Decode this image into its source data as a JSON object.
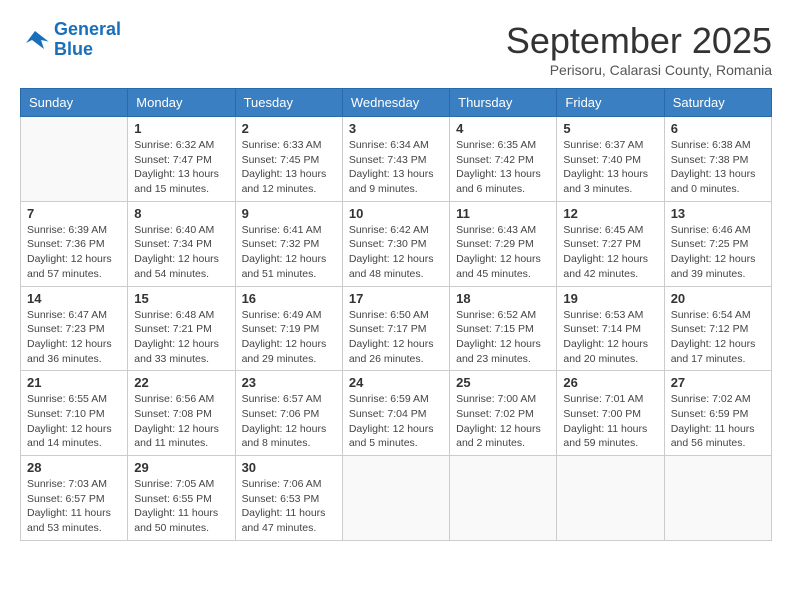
{
  "logo": {
    "line1": "General",
    "line2": "Blue"
  },
  "title": "September 2025",
  "subtitle": "Perisoru, Calarasi County, Romania",
  "days_of_week": [
    "Sunday",
    "Monday",
    "Tuesday",
    "Wednesday",
    "Thursday",
    "Friday",
    "Saturday"
  ],
  "weeks": [
    [
      {
        "day": "",
        "info": ""
      },
      {
        "day": "1",
        "info": "Sunrise: 6:32 AM\nSunset: 7:47 PM\nDaylight: 13 hours\nand 15 minutes."
      },
      {
        "day": "2",
        "info": "Sunrise: 6:33 AM\nSunset: 7:45 PM\nDaylight: 13 hours\nand 12 minutes."
      },
      {
        "day": "3",
        "info": "Sunrise: 6:34 AM\nSunset: 7:43 PM\nDaylight: 13 hours\nand 9 minutes."
      },
      {
        "day": "4",
        "info": "Sunrise: 6:35 AM\nSunset: 7:42 PM\nDaylight: 13 hours\nand 6 minutes."
      },
      {
        "day": "5",
        "info": "Sunrise: 6:37 AM\nSunset: 7:40 PM\nDaylight: 13 hours\nand 3 minutes."
      },
      {
        "day": "6",
        "info": "Sunrise: 6:38 AM\nSunset: 7:38 PM\nDaylight: 13 hours\nand 0 minutes."
      }
    ],
    [
      {
        "day": "7",
        "info": "Sunrise: 6:39 AM\nSunset: 7:36 PM\nDaylight: 12 hours\nand 57 minutes."
      },
      {
        "day": "8",
        "info": "Sunrise: 6:40 AM\nSunset: 7:34 PM\nDaylight: 12 hours\nand 54 minutes."
      },
      {
        "day": "9",
        "info": "Sunrise: 6:41 AM\nSunset: 7:32 PM\nDaylight: 12 hours\nand 51 minutes."
      },
      {
        "day": "10",
        "info": "Sunrise: 6:42 AM\nSunset: 7:30 PM\nDaylight: 12 hours\nand 48 minutes."
      },
      {
        "day": "11",
        "info": "Sunrise: 6:43 AM\nSunset: 7:29 PM\nDaylight: 12 hours\nand 45 minutes."
      },
      {
        "day": "12",
        "info": "Sunrise: 6:45 AM\nSunset: 7:27 PM\nDaylight: 12 hours\nand 42 minutes."
      },
      {
        "day": "13",
        "info": "Sunrise: 6:46 AM\nSunset: 7:25 PM\nDaylight: 12 hours\nand 39 minutes."
      }
    ],
    [
      {
        "day": "14",
        "info": "Sunrise: 6:47 AM\nSunset: 7:23 PM\nDaylight: 12 hours\nand 36 minutes."
      },
      {
        "day": "15",
        "info": "Sunrise: 6:48 AM\nSunset: 7:21 PM\nDaylight: 12 hours\nand 33 minutes."
      },
      {
        "day": "16",
        "info": "Sunrise: 6:49 AM\nSunset: 7:19 PM\nDaylight: 12 hours\nand 29 minutes."
      },
      {
        "day": "17",
        "info": "Sunrise: 6:50 AM\nSunset: 7:17 PM\nDaylight: 12 hours\nand 26 minutes."
      },
      {
        "day": "18",
        "info": "Sunrise: 6:52 AM\nSunset: 7:15 PM\nDaylight: 12 hours\nand 23 minutes."
      },
      {
        "day": "19",
        "info": "Sunrise: 6:53 AM\nSunset: 7:14 PM\nDaylight: 12 hours\nand 20 minutes."
      },
      {
        "day": "20",
        "info": "Sunrise: 6:54 AM\nSunset: 7:12 PM\nDaylight: 12 hours\nand 17 minutes."
      }
    ],
    [
      {
        "day": "21",
        "info": "Sunrise: 6:55 AM\nSunset: 7:10 PM\nDaylight: 12 hours\nand 14 minutes."
      },
      {
        "day": "22",
        "info": "Sunrise: 6:56 AM\nSunset: 7:08 PM\nDaylight: 12 hours\nand 11 minutes."
      },
      {
        "day": "23",
        "info": "Sunrise: 6:57 AM\nSunset: 7:06 PM\nDaylight: 12 hours\nand 8 minutes."
      },
      {
        "day": "24",
        "info": "Sunrise: 6:59 AM\nSunset: 7:04 PM\nDaylight: 12 hours\nand 5 minutes."
      },
      {
        "day": "25",
        "info": "Sunrise: 7:00 AM\nSunset: 7:02 PM\nDaylight: 12 hours\nand 2 minutes."
      },
      {
        "day": "26",
        "info": "Sunrise: 7:01 AM\nSunset: 7:00 PM\nDaylight: 11 hours\nand 59 minutes."
      },
      {
        "day": "27",
        "info": "Sunrise: 7:02 AM\nSunset: 6:59 PM\nDaylight: 11 hours\nand 56 minutes."
      }
    ],
    [
      {
        "day": "28",
        "info": "Sunrise: 7:03 AM\nSunset: 6:57 PM\nDaylight: 11 hours\nand 53 minutes."
      },
      {
        "day": "29",
        "info": "Sunrise: 7:05 AM\nSunset: 6:55 PM\nDaylight: 11 hours\nand 50 minutes."
      },
      {
        "day": "30",
        "info": "Sunrise: 7:06 AM\nSunset: 6:53 PM\nDaylight: 11 hours\nand 47 minutes."
      },
      {
        "day": "",
        "info": ""
      },
      {
        "day": "",
        "info": ""
      },
      {
        "day": "",
        "info": ""
      },
      {
        "day": "",
        "info": ""
      }
    ]
  ]
}
